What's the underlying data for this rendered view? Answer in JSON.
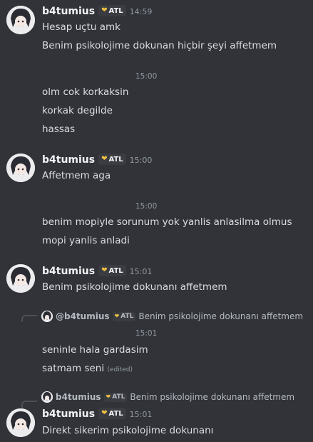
{
  "colors": {
    "background": "#313338",
    "username": "#f2f3f5",
    "text": "#dbdee1",
    "muted": "#949ba4",
    "badge_heart": "#f0c040"
  },
  "messages": [
    {
      "username": "b4tumius",
      "badge": "ATL",
      "time": "14:59",
      "lines": [
        "Hesap uçtu amk",
        "Benim psikolojime dokunan hiçbir şeyi affetmem"
      ]
    },
    {
      "hover_time": "15:00",
      "lines": [
        "olm cok korkaksin",
        "korkak degilde",
        "hassas"
      ]
    },
    {
      "username": "b4tumius",
      "badge": "ATL",
      "time": "15:00",
      "lines": [
        "Affetmem aga"
      ]
    },
    {
      "hover_time": "15:00",
      "lines": [
        "benim mopiyle sorunum yok yanlis anlasilma olmus",
        "mopi yanlis anladi"
      ]
    },
    {
      "username": "b4tumius",
      "badge": "ATL",
      "time": "15:01",
      "lines": [
        "Benim psikolojime dokunanı affetmem"
      ]
    },
    {
      "reply": {
        "mention": "@b4tumius",
        "badge": "ATL",
        "text": "Benim psikolojime dokunanı affetmem"
      },
      "hover_time": "15:01",
      "lines": [
        "seninle hala gardasim",
        "satmam seni"
      ],
      "edited": "(edited)"
    },
    {
      "reply": {
        "mention": "b4tumius",
        "badge": "ATL",
        "text": "Benim psikolojime dokunanı affetmem"
      },
      "username": "b4tumius",
      "badge": "ATL",
      "time": "15:01",
      "lines": [
        "Direkt sikerim psikolojime dokunanı"
      ]
    }
  ]
}
